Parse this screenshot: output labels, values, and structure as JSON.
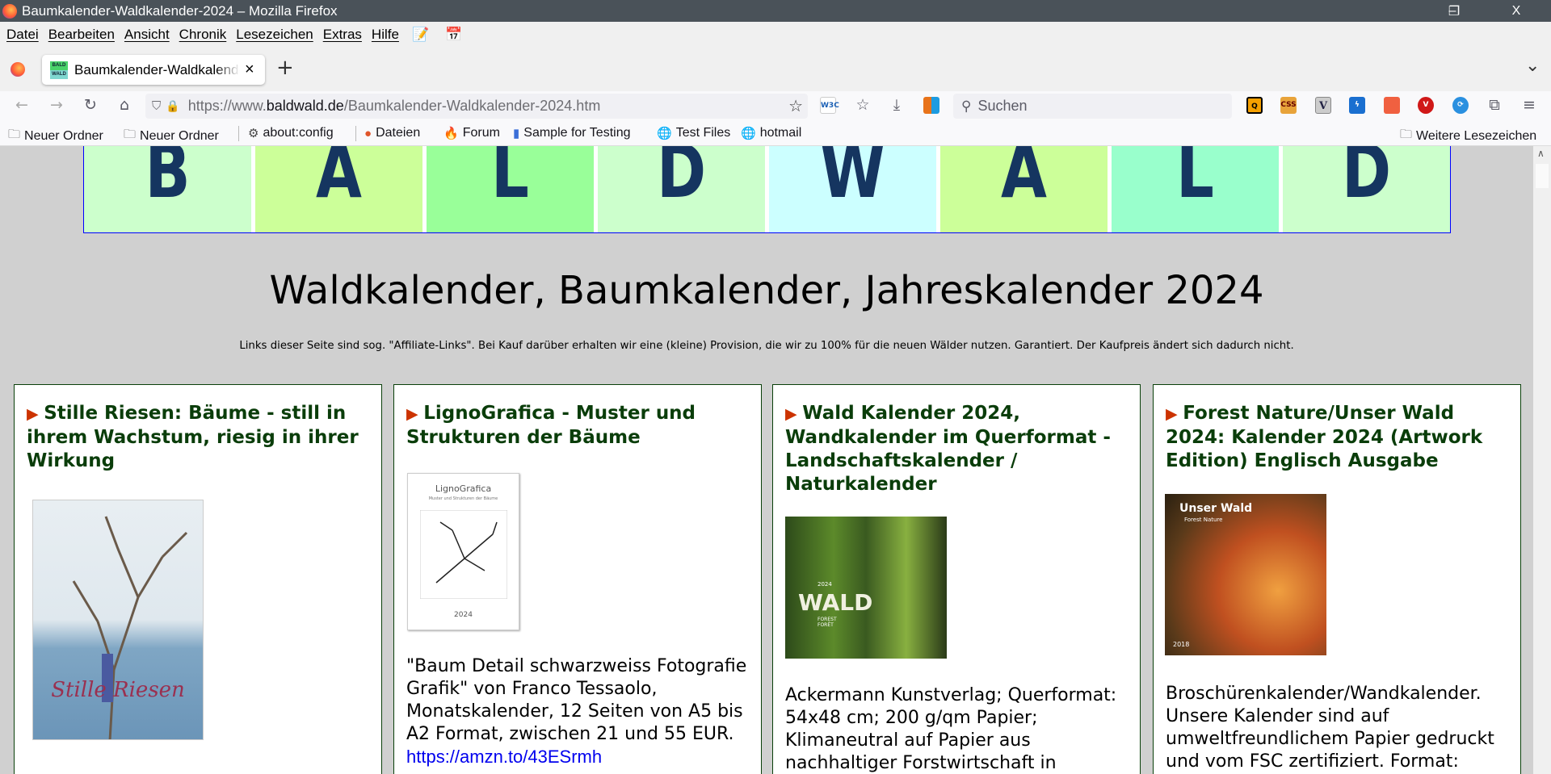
{
  "window": {
    "title": "Baumkalender-Waldkalender-2024 – Mozilla Firefox",
    "minimize": "–",
    "restore": "❐",
    "close": "X"
  },
  "menu": [
    "Datei",
    "Bearbeiten",
    "Ansicht",
    "Chronik",
    "Lesezeichen",
    "Extras",
    "Hilfe"
  ],
  "tab": {
    "title": "Baumkalender-Waldkalender-2024",
    "close": "×",
    "new_tab": "+",
    "favicon_text": "BALD WALD",
    "list_all": "⌄"
  },
  "nav": {
    "url_prefix": "https://www.",
    "url_domain": "baldwald.de",
    "url_path": "/Baumkalender-Waldkalender-2024.htm",
    "search_placeholder": "Suchen"
  },
  "bookmarks": [
    {
      "label": "Neuer Ordner"
    },
    {
      "label": "Neuer Ordner"
    },
    {
      "label": "about:config"
    },
    {
      "label": "Dateien"
    },
    {
      "label": "Forum"
    },
    {
      "label": "Sample for Testing"
    },
    {
      "label": "Test Files"
    },
    {
      "label": "hotmail"
    }
  ],
  "bookmarks_more": "Weitere Lesezeichen",
  "page": {
    "banner_letters": [
      "B",
      "A",
      "L",
      "D",
      "W",
      "A",
      "L",
      "D"
    ],
    "banner_colors": [
      "#ccffcc",
      "#ccff99",
      "#99ff99",
      "#ccffcc",
      "#ccffff",
      "#ccff99",
      "#99ffcc",
      "#ccffcc"
    ],
    "heading": "Waldkalender, Baumkalender, Jahreskalender 2024",
    "disclaimer": "Links dieser Seite sind sog. \"Affiliate-Links\". Bei Kauf darüber erhalten wir eine (kleine) Provision, die wir zu 100% für die neuen Wälder nutzen. Garantiert. Der Kaufpreis ändert sich dadurch nicht.",
    "cards": [
      {
        "title": "Stille Riesen: Bäume - still in ihrem Wachstum, riesig in ihrer Wirkung",
        "cover_text": "Stille Riesen"
      },
      {
        "title": "LignoGrafica - Muster und Strukturen der Bäume",
        "cover_text": "LignoGrafica",
        "cover_sub": "Muster und Strukturen der Bäume",
        "cover_year": "2024",
        "text": "\"Baum Detail schwarzweiss Fotografie Grafik\" von Franco Tessaolo, Monatskalender, 12 Seiten von A5 bis A2 Format, zwischen 21 und 55 EUR. ",
        "link": "https://amzn.to/43ESrmh"
      },
      {
        "title": "Wald Kalender 2024, Wandkalender im Querformat - Landschaftskalender / Naturkalender",
        "cover_text": "WALD",
        "cover_sub": "FOREST FORÊT",
        "cover_year": "2024",
        "text": "Ackermann Kunstverlag; Querformat: 54x48 cm; 200 g/qm Papier; Klimaneutral auf Papier aus nachhaltiger Forstwirtschaft in"
      },
      {
        "title": "Forest Nature/Unser Wald 2024: Kalender 2024 (Artwork Edition) Englisch Ausgabe",
        "cover_text": "Unser Wald",
        "cover_sub": "Forest Nature",
        "cover_year": "2018",
        "text": "Broschürenkalender/Wandkalender. Unsere Kalender sind auf umweltfreundlichem Papier gedruckt und vom FSC zertifiziert. Format:"
      }
    ]
  }
}
